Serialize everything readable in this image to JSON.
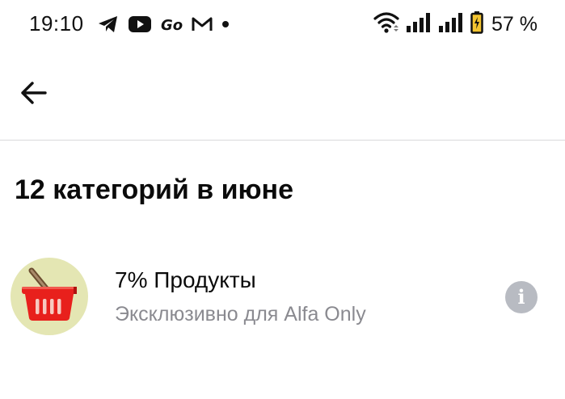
{
  "status_bar": {
    "time": "19:10",
    "notification_icons": [
      "telegram-icon",
      "youtube-icon",
      "go-icon",
      "gmail-icon",
      "dot-icon"
    ],
    "battery_percent": "57 %"
  },
  "app_bar": {
    "back_icon": "arrow-left-icon"
  },
  "page": {
    "title": "12 категорий в июне"
  },
  "categories": [
    {
      "title": "7% Продукты",
      "subtitle": "Эксклюзивно для Alfa Only",
      "icon": "shopping-basket-icon",
      "icon_bg": "#e4e6b3",
      "info_icon": "info-icon"
    }
  ],
  "colors": {
    "text_primary": "#0b0b0b",
    "text_secondary": "#8a8a90",
    "info_bg": "#b8bbc2",
    "divider": "#d9d9dc",
    "basket_red": "#e8201c"
  }
}
